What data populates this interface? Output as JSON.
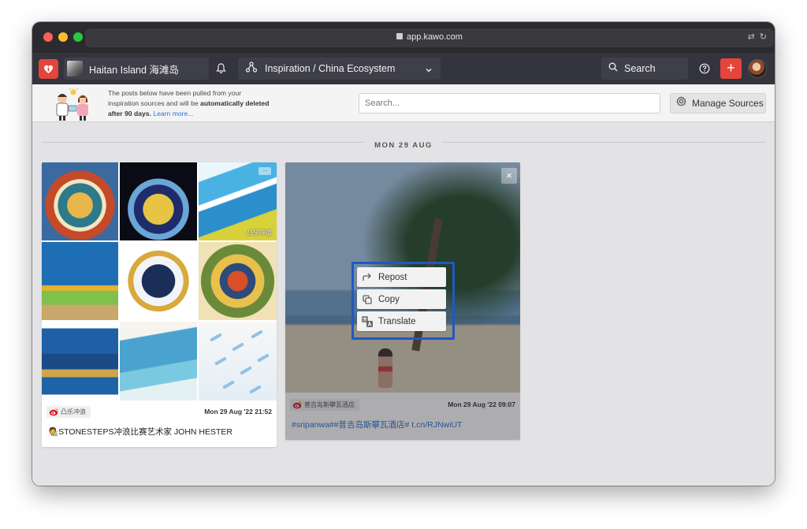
{
  "browser": {
    "url": "app.kawo.com"
  },
  "appbar": {
    "account_label": "Haitan Island 海滩岛",
    "workspace_label": "Inspiration / China Ecosystem",
    "search_label": "Search",
    "add_label": "+"
  },
  "infobar": {
    "text_prefix": "The posts below have been pulled from your inspiration sources and will be",
    "text_bold": "automatically deleted after 90 days.",
    "learn_more": "Learn more...",
    "search_placeholder": "Search...",
    "manage_sources_label": "Manage Sources"
  },
  "feed": {
    "date_label": "MON 29 AUG",
    "posts": [
      {
        "source": "凸乐冲浪",
        "time": "Mon 29 Aug '22 21:52",
        "caption": "🧑‍🎨STONESTEPS冲浪比赛艺术家 JOHN HESTER",
        "watermark": "凸乐冲浪"
      },
      {
        "source": "普吉岛斯攀瓦酒店",
        "time": "Mon 29 Aug '22 09:07",
        "caption": "#sripanwa##普吉岛斯攀瓦酒店# t.cn/RJNwiUT",
        "menu": {
          "repost": "Repost",
          "copy": "Copy",
          "translate": "Translate"
        }
      }
    ]
  },
  "colors": {
    "brand_red": "#e5443a",
    "nav_bg": "#34343e",
    "highlight_blue": "#1f58c6",
    "link_blue": "#2f6fd1"
  }
}
